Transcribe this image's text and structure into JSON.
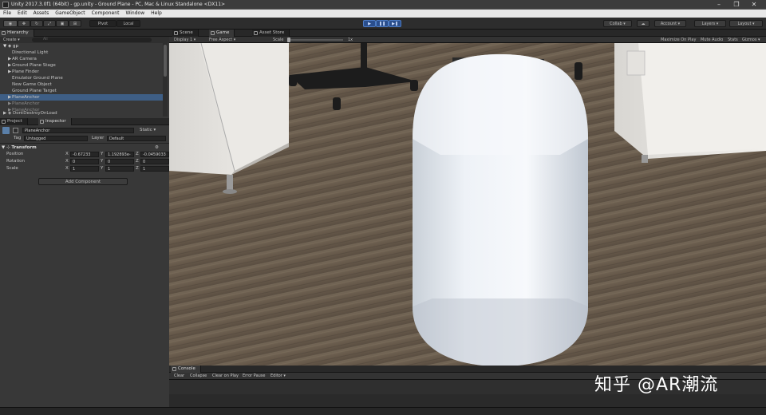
{
  "window": {
    "title": "Unity 2017.3.0f1 (64bit) - gp.unity - Ground Plane - PC, Mac & Linux Standalone <DX11>",
    "controls": [
      "–",
      "❐",
      "✕"
    ]
  },
  "menu": [
    "File",
    "Edit",
    "Assets",
    "GameObject",
    "Component",
    "Window",
    "Help"
  ],
  "toolbar": {
    "pivot": "Pivot",
    "local": "Local",
    "collab": "Collab ▾",
    "account": "Account",
    "layers": "Layers",
    "layout": "Layout"
  },
  "hierarchy": {
    "tab": "Hierarchy",
    "create": "Create ▾",
    "search_placeholder": "All",
    "scene_name": "gp",
    "items": [
      {
        "label": "Directional Light",
        "arrow": ""
      },
      {
        "label": "AR Camera",
        "arrow": "▶"
      },
      {
        "label": "Ground Plane Stage",
        "arrow": "▶"
      },
      {
        "label": "Plane Finder",
        "arrow": "▶"
      },
      {
        "label": "Emulator Ground Plane",
        "arrow": ""
      },
      {
        "label": "New Game Object",
        "arrow": ""
      },
      {
        "label": "Ground Plane Target",
        "arrow": ""
      },
      {
        "label": "PlaneAnchor",
        "arrow": "▶"
      },
      {
        "label": "PlaneAnchor",
        "arrow": "▶"
      },
      {
        "label": "PlaneAnchor",
        "arrow": "▶"
      }
    ],
    "dontdestroy": "DontDestroyOnLoad"
  },
  "inspector": {
    "tab_project": "Project",
    "tab_inspector": "Inspector",
    "object_name": "PlaneAnchor",
    "static_label": "Static ▾",
    "tag_label": "Tag",
    "tag_value": "Untagged",
    "layer_label": "Layer",
    "layer_value": "Default",
    "transform_title": "Transform",
    "position_label": "Position",
    "rotation_label": "Rotation",
    "scale_label": "Scale",
    "position": {
      "x": "-0.67233",
      "y": "1.192893e-",
      "z": "-0.0459033"
    },
    "rotation": {
      "x": "0",
      "y": "0",
      "z": "0"
    },
    "scale": {
      "x": "1",
      "y": "1",
      "z": "1"
    },
    "add_component": "Add Component"
  },
  "view": {
    "tab_scene": "Scene",
    "tab_game": "Game",
    "tab_asset_store": "Asset Store",
    "display": "Display 1 ▾",
    "aspect": "Free Aspect ▾",
    "scale_label": "Scale",
    "scale_value": "1x",
    "maximize": "Maximize On Play",
    "mute": "Mute Audio",
    "stats": "Stats",
    "gizmos": "Gizmos ▾"
  },
  "console": {
    "tab": "Console",
    "buttons": [
      "Clear",
      "Collapse",
      "Clear on Play",
      "Error Pause",
      "Editor ▾"
    ]
  },
  "watermark": "知乎 @AR潮流",
  "colors": {
    "selection": "#3e5e85",
    "play_button": "#2a4e8c",
    "panel_bg": "#383838"
  }
}
